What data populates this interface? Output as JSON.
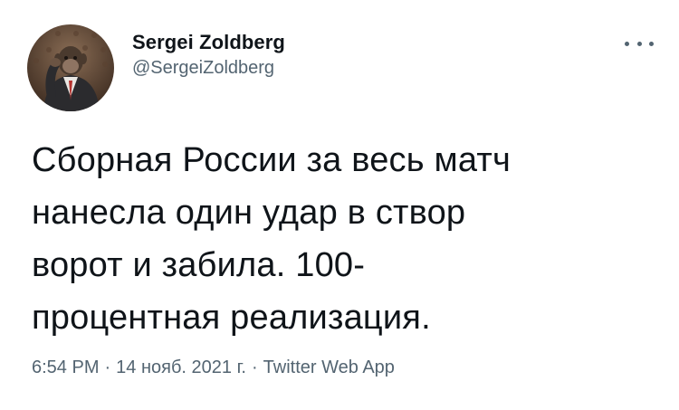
{
  "author": {
    "display_name": "Sergei Zoldberg",
    "handle": "@SergeiZoldberg"
  },
  "tweet": {
    "text": "Сборная России за весь матч\nнанесла один удар в створ\nворот и забила. 100-\nпроцентная реализация."
  },
  "meta": {
    "time": "6:54 PM",
    "separator": "·",
    "date": "14 нояб. 2021 г.",
    "source": "Twitter Web App"
  },
  "icons": {
    "more": "more-horizontal-icon",
    "avatar": "profile-avatar-image"
  },
  "colors": {
    "text_primary": "#0f1419",
    "text_secondary": "#536471",
    "background": "#ffffff"
  }
}
